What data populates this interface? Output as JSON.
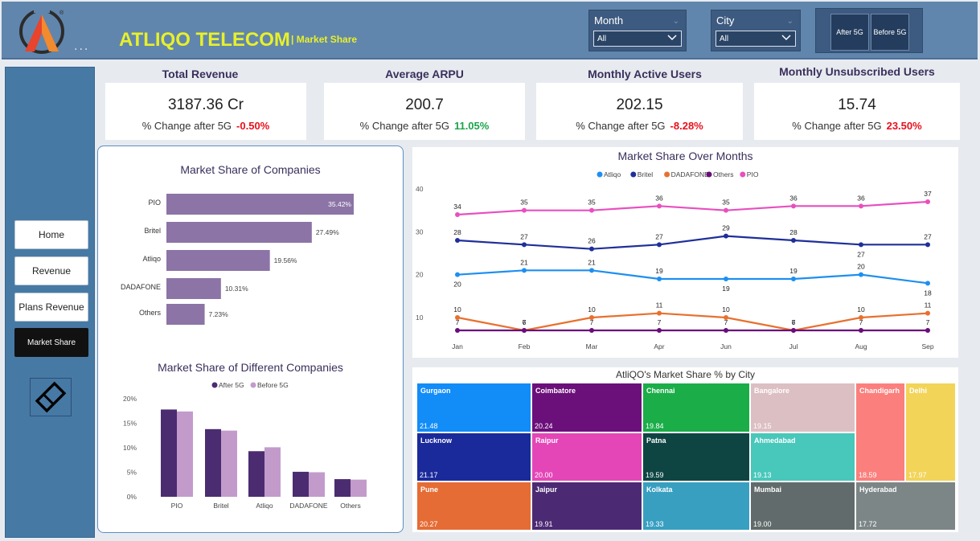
{
  "header": {
    "brand": "ATLIQO TELECOM",
    "subtitle": "| Market Share",
    "dots": "...",
    "month_slicer": {
      "label": "Month",
      "value": "All"
    },
    "city_slicer": {
      "label": "City",
      "value": "All"
    },
    "toggle": {
      "after": "After 5G",
      "before": "Before 5G"
    }
  },
  "sidebar": {
    "items": [
      {
        "label": "Home",
        "active": false
      },
      {
        "label": "Revenue",
        "active": false
      },
      {
        "label": "Plans Revenue",
        "active": false
      },
      {
        "label": "Market Share",
        "active": true
      }
    ]
  },
  "kpis": [
    {
      "title": "Total Revenue",
      "value": "3187.36 Cr",
      "change_label": "% Change after 5G",
      "change": "-0.50%",
      "trend": "negative"
    },
    {
      "title": "Average ARPU",
      "value": "200.7",
      "change_label": "% Change after 5G",
      "change": "11.05%",
      "trend": "positive"
    },
    {
      "title": "Monthly Active Users",
      "value": "202.15",
      "change_label": "% Change after 5G",
      "change": "-8.28%",
      "trend": "negative"
    },
    {
      "title": "Monthly Unsubscribed Users",
      "value": "15.74",
      "change_label": "% Change after 5G",
      "change": "23.50%",
      "trend": "negative"
    }
  ],
  "colors": {
    "header": "#6186ad",
    "sidebar": "#4779a5",
    "brand_yellow": "#e8f02a",
    "bar_purple": "#8c74a6",
    "after_5g": "#4b2c71",
    "before_5g": "#c29bcb"
  },
  "chart_data": [
    {
      "type": "bar",
      "orientation": "horizontal",
      "title": "Market Share of Companies",
      "categories": [
        "PIO",
        "Britel",
        "Atliqo",
        "DADAFONE",
        "Others"
      ],
      "values": [
        35.42,
        27.49,
        19.56,
        10.31,
        7.23
      ],
      "data_labels": [
        "35.42%",
        "27.49%",
        "19.56%",
        "10.31%",
        "7.23%"
      ]
    },
    {
      "type": "bar",
      "title": "Market Share of Different Companies",
      "categories": [
        "PIO",
        "Britel",
        "Atliqo",
        "DADAFONE",
        "Others"
      ],
      "series": [
        {
          "name": "After 5G",
          "values": [
            17.8,
            13.8,
            9.3,
            5.1,
            3.6
          ]
        },
        {
          "name": "Before 5G",
          "values": [
            17.4,
            13.5,
            10.1,
            5.0,
            3.5
          ]
        }
      ],
      "yticks": [
        "0%",
        "5%",
        "10%",
        "15%",
        "20%"
      ],
      "ylim": [
        0,
        20
      ],
      "legend": "top"
    },
    {
      "type": "line",
      "title": "Market Share Over Months",
      "x": [
        "Jan",
        "Feb",
        "Mar",
        "Apr",
        "Jun",
        "Jul",
        "Aug",
        "Sep"
      ],
      "yticks": [
        "10",
        "20",
        "30",
        "40"
      ],
      "ylim": [
        5,
        41
      ],
      "legend": "top",
      "series": [
        {
          "name": "Atliqo",
          "color": "#1e8ff0",
          "values": [
            20,
            21,
            21,
            19,
            19,
            19,
            20,
            18
          ],
          "labels": [
            "20",
            "21",
            "21",
            "19",
            "19",
            "19",
            "20",
            "18"
          ],
          "label_pos": [
            "below",
            "above",
            "above",
            "above",
            "below",
            "above",
            "above",
            "below"
          ]
        },
        {
          "name": "Britel",
          "color": "#1f2f99",
          "values": [
            28,
            27,
            26,
            27,
            29,
            28,
            27,
            27
          ],
          "labels": [
            "28",
            "27",
            "26",
            "27",
            "29",
            "28",
            "27",
            "27"
          ],
          "label_pos": [
            "above",
            "above",
            "above",
            "above",
            "above",
            "above",
            "below",
            "above"
          ]
        },
        {
          "name": "DADAFONE",
          "color": "#e8702e",
          "values": [
            10,
            7,
            10,
            11,
            10,
            7,
            10,
            11
          ],
          "labels": [
            "10",
            "7",
            "10",
            "11",
            "10",
            "7",
            "10",
            "11"
          ],
          "label_pos": [
            "above",
            "above",
            "above",
            "above",
            "above",
            "above",
            "above",
            "above"
          ]
        },
        {
          "name": "Others",
          "color": "#6a0c7b",
          "values": [
            7,
            7,
            7,
            7,
            7,
            7,
            7,
            7
          ],
          "labels": [
            "7",
            "6",
            "7",
            "7",
            "7",
            "6",
            "7",
            "7"
          ],
          "label_pos": [
            "above",
            "above",
            "above",
            "above",
            "above",
            "above",
            "above",
            "above"
          ]
        },
        {
          "name": "PIO",
          "color": "#e84fbf",
          "values": [
            34,
            35,
            35,
            36,
            35,
            36,
            36,
            37
          ],
          "labels": [
            "34",
            "35",
            "35",
            "36",
            "35",
            "36",
            "36",
            "37"
          ],
          "label_pos": [
            "above",
            "above",
            "above",
            "above",
            "above",
            "above",
            "above",
            "above"
          ]
        }
      ]
    },
    {
      "type": "treemap",
      "title": "AtliQO's Market Share % by City",
      "cells": [
        {
          "city": "Gurgaon",
          "value": "21.48",
          "color": "#128cf7"
        },
        {
          "city": "Coimbatore",
          "value": "20.24",
          "color": "#6b0f7a"
        },
        {
          "city": "Chennai",
          "value": "19.84",
          "color": "#1aad48"
        },
        {
          "city": "Bangalore",
          "value": "19.15",
          "color": "#dcbfc3"
        },
        {
          "city": "Chandigarh",
          "value": "18.59",
          "color": "#fb7f7c"
        },
        {
          "city": "Delhi",
          "value": "17.97",
          "color": "#f2d458"
        },
        {
          "city": "Lucknow",
          "value": "21.17",
          "color": "#1b2a9b"
        },
        {
          "city": "Raipur",
          "value": "20.00",
          "color": "#e446b7"
        },
        {
          "city": "Patna",
          "value": "19.59",
          "color": "#0e4543"
        },
        {
          "city": "Ahmedabad",
          "value": "19.13",
          "color": "#48c7bb"
        },
        {
          "city": "Pune",
          "value": "20.27",
          "color": "#e56c34"
        },
        {
          "city": "Jaipur",
          "value": "19.91",
          "color": "#4c2a73"
        },
        {
          "city": "Kolkata",
          "value": "19.33",
          "color": "#389fc1"
        },
        {
          "city": "Mumbai",
          "value": "19.00",
          "color": "#626b6b"
        },
        {
          "city": "Hyderabad",
          "value": "17.72",
          "color": "#7d8686"
        }
      ]
    }
  ]
}
